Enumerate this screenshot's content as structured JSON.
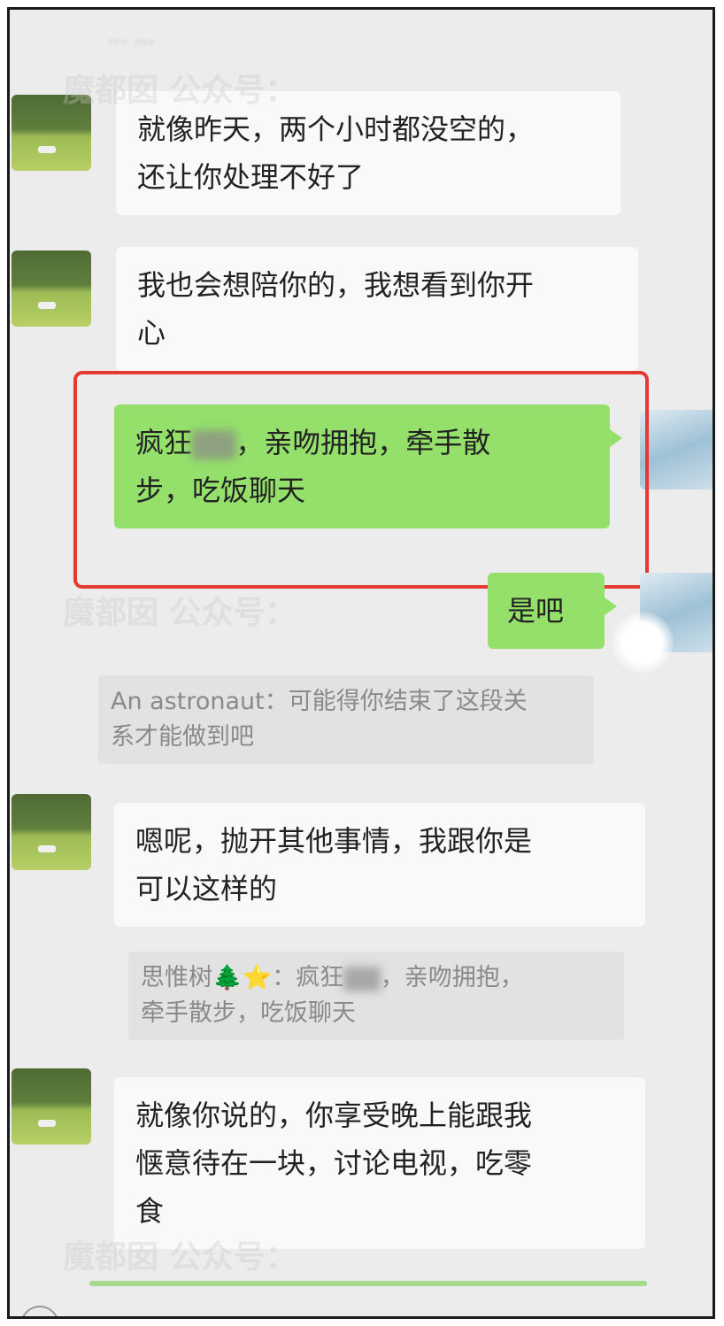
{
  "header": {
    "faded_text": "... ..."
  },
  "messages": [
    {
      "side": "left",
      "text": "就像昨天，两个小时都没空的，\n还让你处理不好了"
    },
    {
      "side": "left",
      "text": "我也会想陪你的，我想看到你开\n心"
    },
    {
      "side": "right",
      "text_before": "疯狂",
      "text_blurred": "▇▇",
      "text_after": "，亲吻拥抱，牵手散\n步，吃饭聊天"
    },
    {
      "side": "right",
      "text": "是吧"
    },
    {
      "side": "left",
      "text": "嗯呢，抛开其他事情，我跟你是\n可以这样的"
    },
    {
      "side": "left",
      "text": "就像你说的，你享受晚上能跟我\n惬意待在一块，讨论电视，吃零\n食"
    }
  ],
  "quotes": [
    {
      "text": "An astronaut：可能得你结束了这段关\n系才能做到吧"
    },
    {
      "prefix": "思惟树",
      "emoji": "🌲",
      "star": "⭐",
      "middle": "：疯狂",
      "blurred": "▇▇",
      "suffix": "，亲吻拥抱，\n牵手散步，吃饭聊天"
    }
  ],
  "watermark": "魔都囡 公众号："
}
